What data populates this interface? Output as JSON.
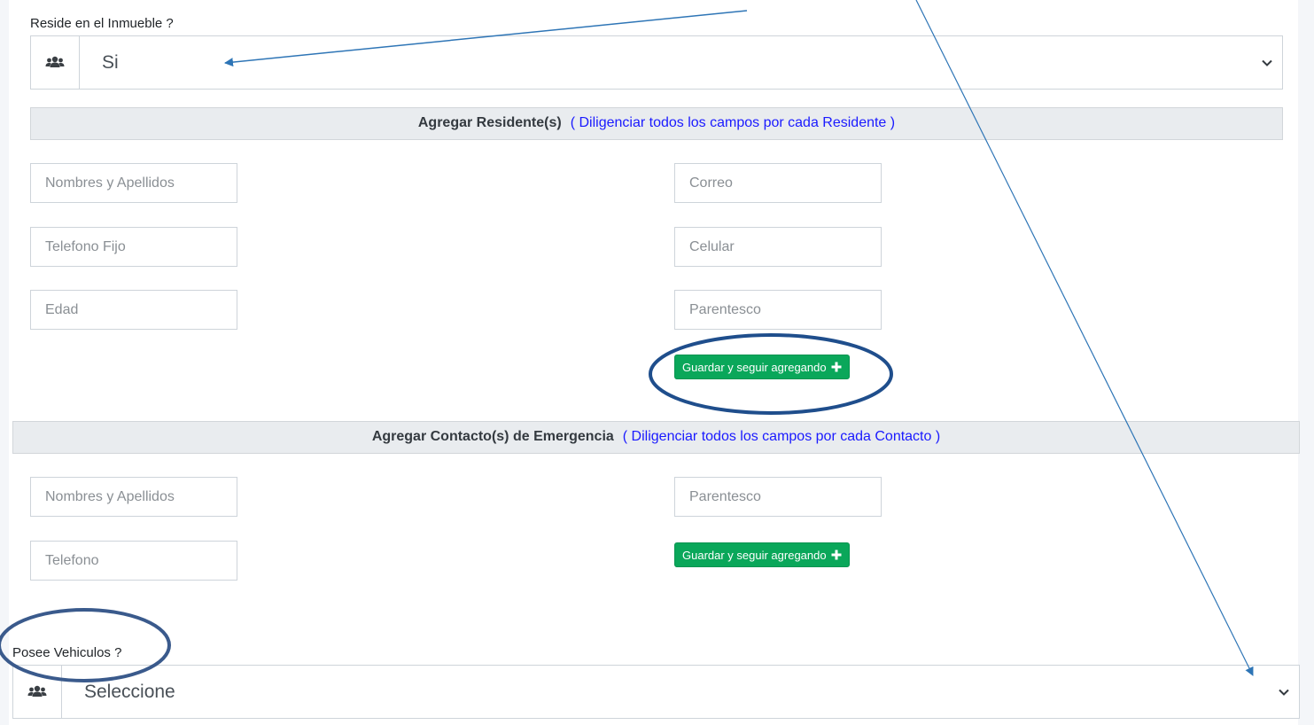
{
  "reside": {
    "label": "Reside en el Inmueble ?",
    "selected": "Si",
    "icon": "users-icon"
  },
  "residents_section": {
    "title": "Agregar Residente(s)",
    "hint": "( Diligenciar todos los campos por cada Residente )",
    "fields": {
      "nombres_placeholder": "Nombres y Apellidos",
      "correo_placeholder": "Correo",
      "telefono_fijo_placeholder": "Telefono Fijo",
      "celular_placeholder": "Celular",
      "edad_placeholder": "Edad",
      "parentesco_placeholder": "Parentesco"
    },
    "save_button": "Guardar y seguir agregando"
  },
  "emergency_section": {
    "title": "Agregar Contacto(s) de Emergencia",
    "hint": "( Diligenciar todos los campos por cada Contacto )",
    "fields": {
      "nombres_placeholder": "Nombres y Apellidos",
      "parentesco_placeholder": "Parentesco",
      "telefono_placeholder": "Telefono"
    },
    "save_button": "Guardar y seguir agregando"
  },
  "vehiculos": {
    "label": "Posee Vehiculos ?",
    "selected": "Seleccione",
    "icon": "users-icon"
  },
  "colors": {
    "button_green": "#0aa75a",
    "hint_blue": "#1a1aff",
    "annotation_blue": "#2e75b6",
    "annotation_circle": "#1f4e8c"
  }
}
